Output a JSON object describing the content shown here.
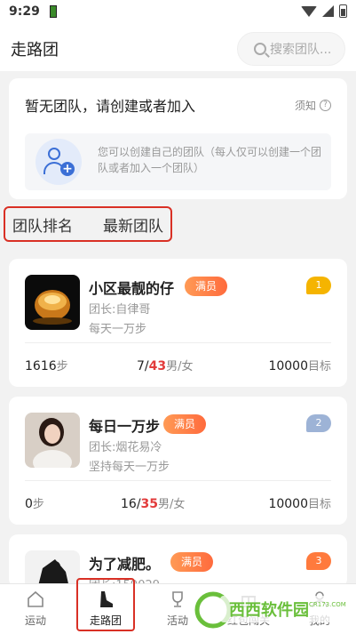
{
  "status_bar": {
    "time": "9:29"
  },
  "header": {
    "title": "走路团",
    "search_placeholder": "搜索团队..."
  },
  "no_team": {
    "title": "暂无团队，请创建或者加入",
    "notice_label": "须知",
    "description": "您可以创建自己的团队（每人仅可以创建一个团队或者加入一个团队）"
  },
  "tabs": [
    {
      "label": "团队排名",
      "active": true
    },
    {
      "label": "最新团队",
      "active": false
    }
  ],
  "teams": [
    {
      "name": "小区最靓的仔",
      "badge": "满员",
      "rank": "1",
      "rank_color": "#f5b400",
      "leader": "团长:自律哥",
      "slogan": "每天一万步",
      "steps": "1616",
      "steps_unit": "步",
      "male": "7",
      "sep": "/",
      "female": "43",
      "gender_unit": "男/女",
      "goal": "10000",
      "goal_unit": "目标"
    },
    {
      "name": "每日一万步",
      "badge": "满员",
      "rank": "2",
      "rank_color": "#9db3d6",
      "leader": "团长:烟花易冷",
      "slogan": "坚持每天一万步",
      "steps": "0",
      "steps_unit": "步",
      "male": "16",
      "sep": "/",
      "female": "35",
      "gender_unit": "男/女",
      "goal": "10000",
      "goal_unit": "目标"
    },
    {
      "name": "为了减肥。",
      "badge": "满员",
      "rank": "3",
      "rank_color": "#ff7a3d",
      "leader": "团长:159029..."
    }
  ],
  "tabbar": [
    {
      "label": "运动",
      "icon": "home-icon"
    },
    {
      "label": "走路团",
      "icon": "shoe-icon",
      "active": true
    },
    {
      "label": "活动",
      "icon": "trophy-icon"
    },
    {
      "label": "红包闯关",
      "icon": "gift-icon"
    },
    {
      "label": "我的",
      "icon": "user-icon"
    }
  ],
  "watermark": {
    "text": "西西软件园",
    "url_text": "CR173.COM"
  }
}
